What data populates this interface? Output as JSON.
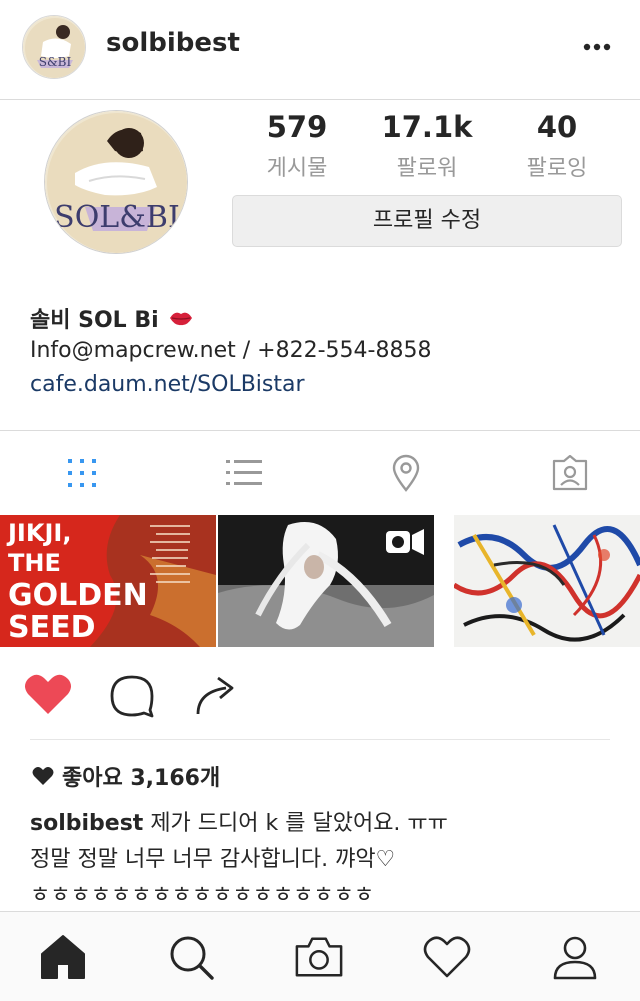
{
  "header": {
    "username": "solbibest",
    "more_icon": "more-dots-icon"
  },
  "profile": {
    "avatar_text": "SOL&BI",
    "stats": [
      {
        "value": "579",
        "label": "게시물"
      },
      {
        "value": "17.1k",
        "label": "팔로워"
      },
      {
        "value": "40",
        "label": "팔로잉"
      }
    ],
    "edit_button_label": "프로필 수정",
    "bio": {
      "name": "솔비 SOL Bi",
      "name_icon": "lips-icon",
      "contact": "Info@mapcrew.net / +822-554-8858",
      "link": "cafe.daum.net/SOLBistar"
    }
  },
  "tabs": [
    {
      "icon": "grid-icon",
      "active": true
    },
    {
      "icon": "list-icon",
      "active": false
    },
    {
      "icon": "location-pin-icon",
      "active": false
    },
    {
      "icon": "tagged-person-icon",
      "active": false
    }
  ],
  "grid": {
    "thumb1_text": [
      "JIKJI,",
      "THE",
      "GOLDEN",
      "SEED"
    ],
    "thumb2_badge": "video-camera-icon",
    "thumb3": "abstract-painting"
  },
  "post": {
    "liked": true,
    "likes_text": "좋아요 3,166개",
    "caption_user": "solbibest",
    "caption_line1": " 제가 드디어 k 를 달았어요. ㅠㅠ",
    "caption_line2": "정말 정말 너무 너무 감사합니다. 꺄악♡",
    "caption_line3": "ㅎㅎㅎㅎㅎㅎㅎㅎㅎㅎㅎㅎㅎㅎㅎㅎㅎ"
  },
  "colors": {
    "heart_red": "#ed4956",
    "link_blue": "#1b3a66",
    "active_tab_blue": "#3897f0",
    "muted_gray": "#999999"
  },
  "bottom_nav": [
    "home-icon",
    "search-icon",
    "camera-icon",
    "heart-icon",
    "profile-icon"
  ]
}
